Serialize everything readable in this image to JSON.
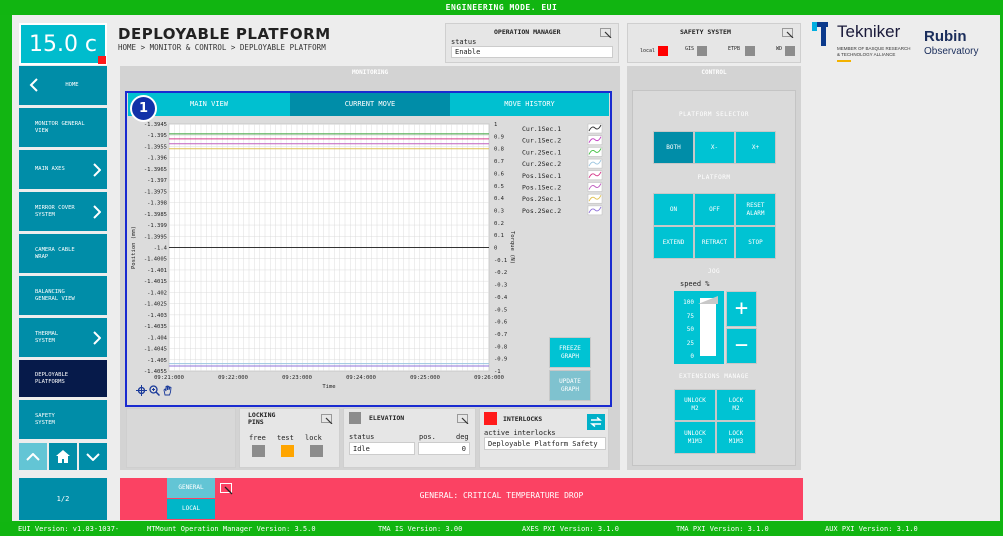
{
  "topbar": {
    "title": "ENGINEERING MODE. EUI"
  },
  "temperature": {
    "value": "15.0 c"
  },
  "header": {
    "title": "DEPLOYABLE PLATFORM",
    "breadcrumb": "HOME > MONITOR & CONTROL > DEPLOYABLE PLATFORM"
  },
  "sidebar": {
    "items": [
      {
        "label": "HOME"
      },
      {
        "label": "MONITOR GENERAL VIEW"
      },
      {
        "label": "MAIN AXES"
      },
      {
        "label": "MIRROR COVER SYSTEM"
      },
      {
        "label": "CAMERA CABLE WRAP"
      },
      {
        "label": "BALANCING GENERAL VIEW"
      },
      {
        "label": "THERMAL SYSTEM"
      },
      {
        "label": "DEPLOYABLE PLATFORMS"
      },
      {
        "label": "SAFETY SYSTEM"
      }
    ],
    "page": "1/2"
  },
  "operation_manager": {
    "title": "OPERATION MANAGER",
    "status_label": "status",
    "status_value": "Enable"
  },
  "safety_system": {
    "title": "SAFETY SYSTEM",
    "items": [
      "local",
      "GIS",
      "ETPB",
      "WD"
    ]
  },
  "logos": {
    "tekniker": "Tekniker",
    "tekniker_sub1": "MEMBER OF BASQUE RESEARCH",
    "tekniker_sub2": "& TECHNOLOGY ALLIANCE",
    "rubin1": "Rubin",
    "rubin2": "Observatory"
  },
  "monitoring": {
    "title": "MONITORING",
    "badge": "1",
    "tabs": [
      "MAIN VIEW",
      "CURRENT MOVE",
      "MOVE HISTORY"
    ],
    "freeze": "FREEZE GRAPH",
    "update": "UPDATE GRAPH"
  },
  "chart_data": {
    "type": "line",
    "ylabel": "Position (mm)",
    "y2label": "Torque (N)",
    "xlabel": "Time",
    "y_ticks": [
      "-1.3945",
      "-1.395",
      "-1.3955",
      "-1.396",
      "-1.3965",
      "-1.397",
      "-1.3975",
      "-1.398",
      "-1.3985",
      "-1.399",
      "-1.3995",
      "-1.4",
      "-1.4005",
      "-1.401",
      "-1.4015",
      "-1.402",
      "-1.4025",
      "-1.403",
      "-1.4035",
      "-1.404",
      "-1.4045",
      "-1.405",
      "-1.4055"
    ],
    "y2_ticks": [
      "1",
      "0.9",
      "0.8",
      "0.7",
      "0.6",
      "0.5",
      "0.4",
      "0.3",
      "0.2",
      "0.1",
      "0",
      "-0.1",
      "-0.2",
      "-0.3",
      "-0.4",
      "-0.5",
      "-0.6",
      "-0.7",
      "-0.8",
      "-0.9",
      "-1"
    ],
    "x_ticks": [
      "09:21:000",
      "09:22:000",
      "09:23:000",
      "09:24:000",
      "09:25:000",
      "09:26:000"
    ],
    "series": [
      {
        "name": "Cur.1Sec.1",
        "color": "#333333"
      },
      {
        "name": "Cur.1Sec.2",
        "color": "#c33ec3"
      },
      {
        "name": "Cur.2Sec.1",
        "color": "#3fbf3f"
      },
      {
        "name": "Cur.2Sec.2",
        "color": "#9ac4df"
      },
      {
        "name": "Pos.1Sec.1",
        "color": "#d63a8a"
      },
      {
        "name": "Pos.1Sec.2",
        "color": "#c060c0"
      },
      {
        "name": "Pos.2Sec.1",
        "color": "#e0c050"
      },
      {
        "name": "Pos.2Sec.2",
        "color": "#8d6fd8"
      }
    ]
  },
  "control": {
    "title": "CONTROL",
    "platform_selector": "PLATFORM SELECTOR",
    "selector_buttons": [
      "BOTH",
      "X-",
      "X+"
    ],
    "platform": "PLATFORM",
    "platform_buttons": [
      "ON",
      "OFF",
      "RESET ALARM",
      "EXTEND",
      "RETRACT",
      "STOP"
    ],
    "jog": "JOG",
    "speed_label": "speed %",
    "speed_ticks": [
      "100",
      "75",
      "50",
      "25",
      "0"
    ],
    "speed_value_percent": 100,
    "plus": "+",
    "minus": "−",
    "extensions": "EXTENSIONS MANAGE",
    "extension_buttons": [
      "UNLOCK M2",
      "LOCK M2",
      "UNLOCK M1M3",
      "LOCK M1M3"
    ]
  },
  "locking_pins": {
    "title": "LOCKING PINS",
    "labels": [
      "free",
      "test",
      "lock"
    ]
  },
  "elevation": {
    "title": "ELEVATION",
    "status_label": "status",
    "pos_label": "pos.",
    "deg_label": "deg",
    "status": "Idle",
    "pos": "0"
  },
  "interlocks": {
    "title": "INTERLOCKS",
    "label": "active interlocks",
    "value": "Deployable Platform Safety"
  },
  "alarm": {
    "tab_general": "GENERAL",
    "tab_local": "LOCAL",
    "message": "GENERAL: CRITICAL TEMPERATURE DROP"
  },
  "footer": {
    "items": [
      "EUI Version: v1.03-1037-",
      "MTMount Operation Manager Version: 3.5.0",
      "TMA IS Version: 3.00",
      "AXES PXI Version: 3.1.0",
      "TMA PXI Version: 3.1.0",
      "AUX PXI Version: 3.1.0"
    ]
  }
}
